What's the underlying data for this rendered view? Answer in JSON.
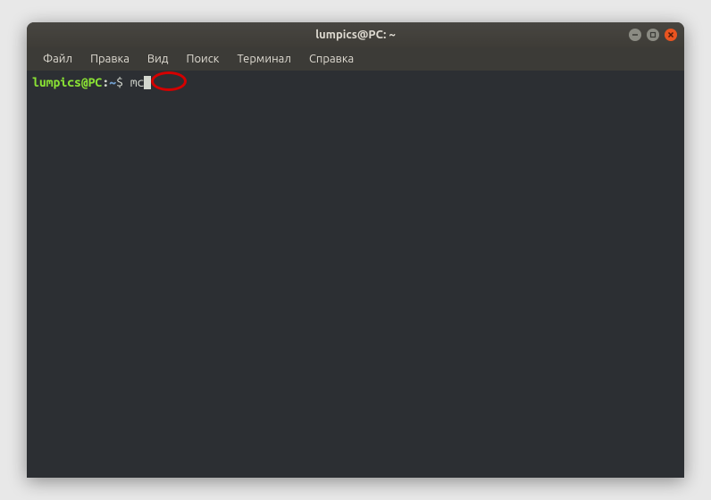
{
  "window": {
    "title": "lumpics@PC: ~"
  },
  "menu": {
    "items": [
      "Файл",
      "Правка",
      "Вид",
      "Поиск",
      "Терминал",
      "Справка"
    ]
  },
  "prompt": {
    "userhost": "lumpics@PC",
    "colon": ":",
    "path": "~",
    "symbol": "$ "
  },
  "terminal": {
    "command": "mc"
  },
  "colors": {
    "prompt_user": "#8ae234",
    "prompt_path": "#729fcf",
    "text": "#d3d7cf",
    "background": "#2c2f33",
    "close_btn": "#e95420",
    "highlight": "#d40000"
  }
}
